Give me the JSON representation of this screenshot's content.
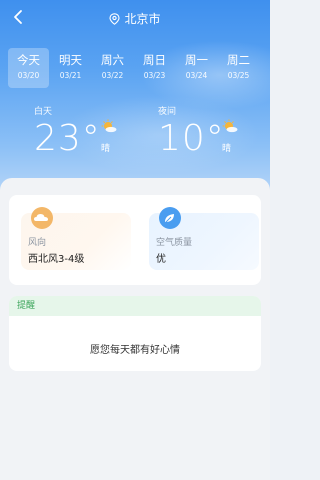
{
  "header": {
    "location": "北京市"
  },
  "days": [
    {
      "name": "今天",
      "date": "03/20",
      "active": true
    },
    {
      "name": "明天",
      "date": "03/21",
      "active": false
    },
    {
      "name": "周六",
      "date": "03/22",
      "active": false
    },
    {
      "name": "周日",
      "date": "03/23",
      "active": false
    },
    {
      "name": "周一",
      "date": "03/24",
      "active": false
    },
    {
      "name": "周二",
      "date": "03/25",
      "active": false
    }
  ],
  "day_weather": {
    "label": "白天",
    "temp": "23°",
    "condition": "晴"
  },
  "night_weather": {
    "label": "夜间",
    "temp": "10°",
    "condition": "晴"
  },
  "cards": {
    "wind": {
      "label": "风向",
      "value": "西北风3-4级",
      "icon": "cloud-icon"
    },
    "air": {
      "label": "空气质量",
      "value": "优",
      "icon": "leaf-icon"
    }
  },
  "reminder": {
    "title": "提醒",
    "message": "愿您每天都有好心情"
  },
  "colors": {
    "accent": "#3f90ee",
    "reminder_green": "#3ca55b",
    "sun": "#f5b53a"
  }
}
